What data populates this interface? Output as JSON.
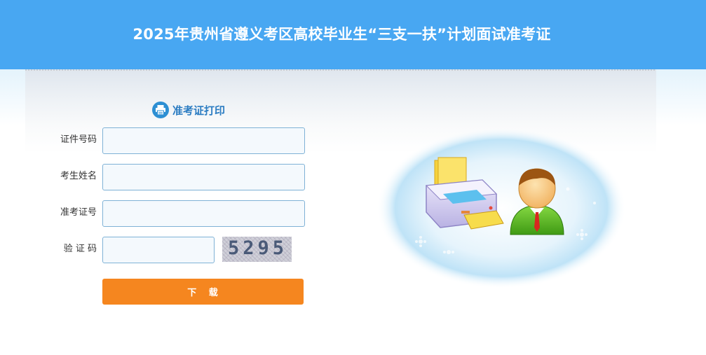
{
  "header": {
    "title": "2025年贵州省遵义考区高校毕业生“三支一扶”计划面试准考证",
    "bg_color": "#48a7f2"
  },
  "form": {
    "title": "准考证打印",
    "title_icon": "printer-icon",
    "fields": {
      "id_number": {
        "label": "证件号码",
        "value": "",
        "placeholder": ""
      },
      "name": {
        "label": "考生姓名",
        "value": "",
        "placeholder": ""
      },
      "ticket_number": {
        "label": "准考证号",
        "value": "",
        "placeholder": ""
      },
      "captcha": {
        "label": "验 证 码",
        "value": "",
        "placeholder": ""
      }
    },
    "captcha_image_text": "5295",
    "submit_label": "下   载",
    "submit_color": "#f5861f"
  },
  "illustration": {
    "icons": [
      "printer-icon",
      "user-avatar-icon"
    ]
  }
}
